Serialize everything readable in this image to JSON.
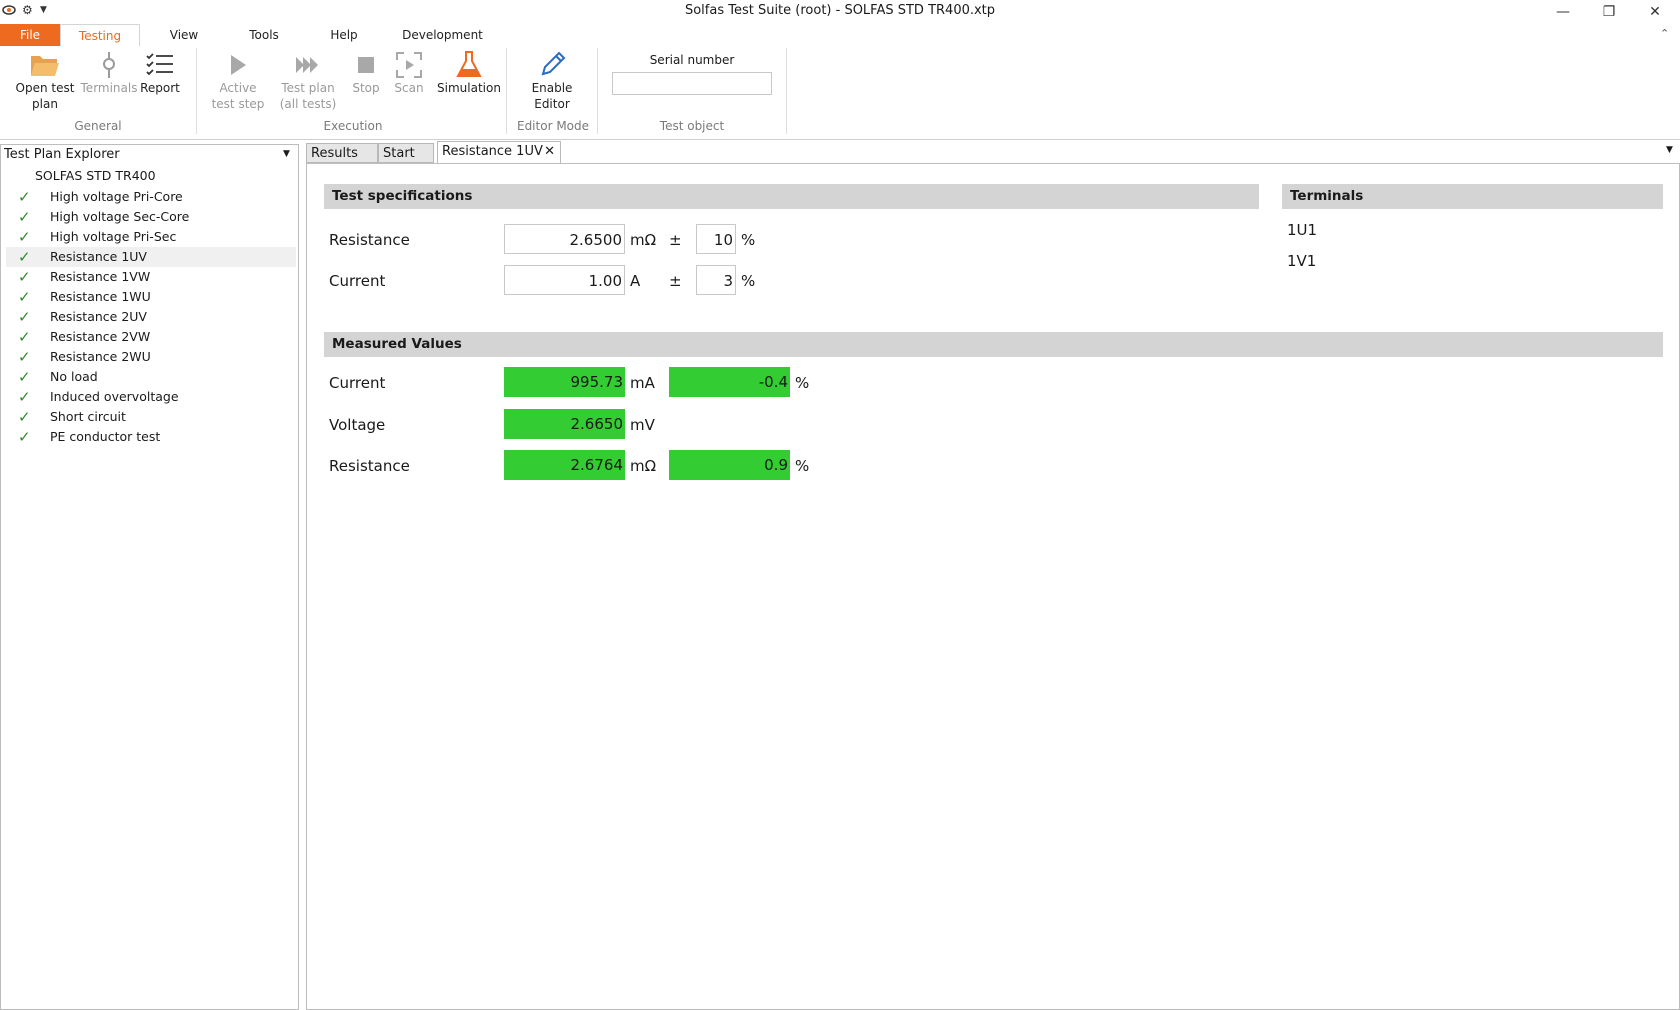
{
  "window": {
    "title": "Solfas Test Suite (root)  - SOLFAS STD TR400.xtp"
  },
  "menu": [
    "File",
    "Testing",
    "View",
    "Tools",
    "Help",
    "Development"
  ],
  "ribbon": {
    "general": {
      "label": "General",
      "open_test_plan": "Open test plan",
      "terminals": "Terminals",
      "report": "Report"
    },
    "execution": {
      "label": "Execution",
      "active_test_step": "Active test step",
      "test_plan_all": "Test plan (all tests)",
      "stop": "Stop",
      "scan": "Scan",
      "simulation": "Simulation"
    },
    "editor_mode": {
      "label": "Editor Mode",
      "enable_editor": "Enable Editor"
    },
    "test_object": {
      "label": "Test object",
      "serial_number_label": "Serial number",
      "serial_number_value": ""
    }
  },
  "explorer": {
    "title": "Test Plan Explorer",
    "root": "SOLFAS STD TR400",
    "items": [
      {
        "label": "High voltage Pri-Core",
        "selected": false
      },
      {
        "label": "High voltage Sec-Core",
        "selected": false
      },
      {
        "label": "High voltage Pri-Sec",
        "selected": false
      },
      {
        "label": "Resistance 1UV",
        "selected": true
      },
      {
        "label": "Resistance 1VW",
        "selected": false
      },
      {
        "label": "Resistance 1WU",
        "selected": false
      },
      {
        "label": "Resistance 2UV",
        "selected": false
      },
      {
        "label": "Resistance 2VW",
        "selected": false
      },
      {
        "label": "Resistance 2WU",
        "selected": false
      },
      {
        "label": "No load",
        "selected": false
      },
      {
        "label": "Induced overvoltage",
        "selected": false
      },
      {
        "label": "Short circuit",
        "selected": false
      },
      {
        "label": "PE conductor test",
        "selected": false
      }
    ]
  },
  "tabs": [
    "Results",
    "Start",
    "Resistance 1UV"
  ],
  "specs": {
    "title": "Test specifications",
    "rows": [
      {
        "label": "Resistance",
        "value": "2.6500",
        "unit": "mΩ",
        "pm": "±",
        "tol": "10",
        "tol_unit": "%"
      },
      {
        "label": "Current",
        "value": "1.00",
        "unit": "A",
        "pm": "±",
        "tol": "3",
        "tol_unit": "%"
      }
    ]
  },
  "terminals": {
    "title": "Terminals",
    "items": [
      "1U1",
      "1V1"
    ]
  },
  "measured": {
    "title": "Measured Values",
    "rows": [
      {
        "label": "Current",
        "value": "995.73",
        "unit": "mA",
        "dev": "-0.4",
        "dev_unit": "%"
      },
      {
        "label": "Voltage",
        "value": "2.6650",
        "unit": "mV",
        "dev": "",
        "dev_unit": ""
      },
      {
        "label": "Resistance",
        "value": "2.6764",
        "unit": "mΩ",
        "dev": "0.9",
        "dev_unit": "%"
      }
    ]
  },
  "colors": {
    "accent": "#ee6a1f",
    "pass": "#33cc33",
    "check": "#2e8b2e"
  }
}
